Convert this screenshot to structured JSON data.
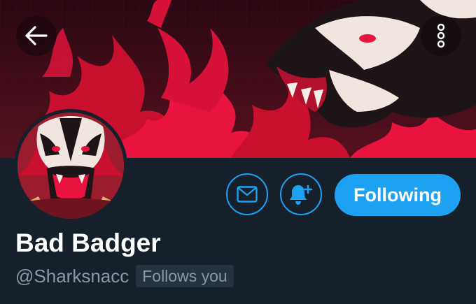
{
  "header": {
    "back_icon": "arrow-left-icon",
    "more_icon": "more-vertical-icon"
  },
  "profile": {
    "display_name": "Bad Badger",
    "handle": "@Sharksnacc",
    "follows_you_label": "Follows you"
  },
  "actions": {
    "message_icon": "mail-icon",
    "notify_icon": "bell-plus-icon",
    "follow_label": "Following"
  },
  "colors": {
    "background": "#15202b",
    "accent": "#1da1f2",
    "text_primary": "#ffffff",
    "text_secondary": "#8899a6",
    "badge_bg": "#253341",
    "banner_dark": "#3a0c16",
    "banner_flame": "#e8133f"
  }
}
